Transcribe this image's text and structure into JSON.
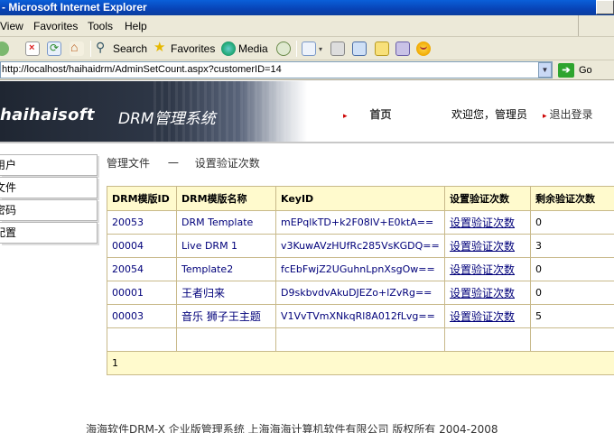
{
  "window": {
    "title": "- Microsoft Internet Explorer"
  },
  "menu": {
    "items": [
      "View",
      "Favorites",
      "Tools",
      "Help"
    ]
  },
  "toolbar": {
    "search": "Search",
    "favorites": "Favorites",
    "media": "Media"
  },
  "address": {
    "url": "http://localhost/haihaidrm/AdminSetCount.aspx?customerID=14",
    "go": "Go"
  },
  "header": {
    "brand": "haihaisoft",
    "brand_sub": "DRM管理系统",
    "home": "首页",
    "welcome": "欢迎您，管理员",
    "logout": "退出登录"
  },
  "sidebar": {
    "items": [
      "用户",
      "文件",
      "密码",
      "配置"
    ]
  },
  "breadcrumb": {
    "parent": "管理文件",
    "sep": "一",
    "current": "设置验证次数"
  },
  "table": {
    "headers": [
      "DRM模版ID",
      "DRM模版名称",
      "KeyID",
      "设置验证次数",
      "剩余验证次数"
    ],
    "rows": [
      {
        "id": "20053",
        "name": "DRM Template",
        "key": "mEPqlkTD+k2F08lV+E0ktA==",
        "action": "设置验证次数",
        "remaining": "0"
      },
      {
        "id": "00004",
        "name": "Live DRM 1",
        "key": "v3KuwAVzHUfRc285VsKGDQ==",
        "action": "设置验证次数",
        "remaining": "3"
      },
      {
        "id": "20054",
        "name": "Template2",
        "key": "fcEbFwjZ2UGuhnLpnXsgOw==",
        "action": "设置验证次数",
        "remaining": "0"
      },
      {
        "id": "00001",
        "name": "王者归来",
        "key": "D9skbvdvAkuDJEZo+lZvRg==",
        "action": "设置验证次数",
        "remaining": "0"
      },
      {
        "id": "00003",
        "name": "音乐 狮子王主题",
        "key": "V1VvTVmXNkqRl8A012fLvg==",
        "action": "设置验证次数",
        "remaining": "5"
      }
    ],
    "pager": "1"
  },
  "footer": {
    "text": "海海软件DRM-X 企业版管理系统 上海海海计算机软件有限公司 版权所有 2004-2008"
  },
  "colors": {
    "header_bg": "#fffacd",
    "link": "#00007a",
    "title_bar": "#0843b6"
  }
}
